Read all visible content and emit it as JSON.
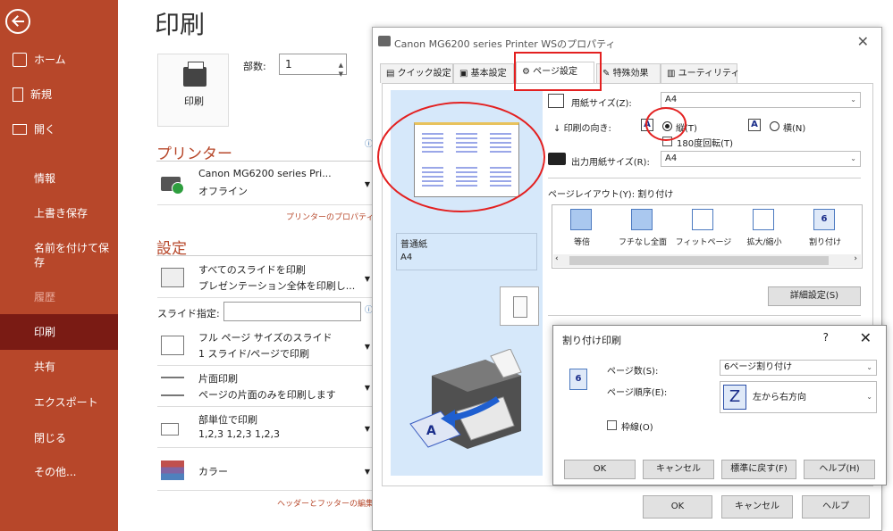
{
  "sidebar": {
    "items": [
      {
        "label": "ホーム",
        "icon": "home-icon"
      },
      {
        "label": "新規",
        "icon": "new-document-icon"
      },
      {
        "label": "開く",
        "icon": "open-folder-icon"
      },
      {
        "label": "情報"
      },
      {
        "label": "上書き保存"
      },
      {
        "label": "名前を付けて保\n存"
      },
      {
        "label": "履歴"
      },
      {
        "label": "印刷"
      },
      {
        "label": "共有"
      },
      {
        "label": "エクスポート"
      },
      {
        "label": "閉じる"
      },
      {
        "label": "その他..."
      }
    ],
    "active": "印刷"
  },
  "print_pane": {
    "title": "印刷",
    "print_button": "印刷",
    "copies_label": "部数:",
    "copies_value": "1",
    "printer_heading": "プリンター",
    "printer_name": "Canon MG6200 series Pri...",
    "printer_status": "オフライン",
    "printer_props_link": "プリンターのプロパティ",
    "settings_heading": "設定",
    "opt_slides_l1": "すべてのスライドを印刷",
    "opt_slides_l2": "プレゼンテーション全体を印刷し...",
    "slide_spec_label": "スライド指定:",
    "opt_layout_l1": "フル ページ サイズのスライド",
    "opt_layout_l2": "1 スライド/ページで印刷",
    "opt_sides_l1": "片面印刷",
    "opt_sides_l2": "ページの片面のみを印刷します",
    "opt_collate_l1": "部単位で印刷",
    "opt_collate_l2": "1,2,3    1,2,3    1,2,3",
    "opt_color_l1": "カラー",
    "header_footer_link": "ヘッダーとフッターの編集"
  },
  "props_dialog": {
    "title": "Canon MG6200 series Printer WSのプロパティ",
    "tabs": [
      "クイック設定",
      "基本設定",
      "ページ設定",
      "特殊効果",
      "ユーティリティ"
    ],
    "selected_tab": "ページ設定",
    "paper_size_label": "用紙サイズ(Z):",
    "paper_size_value": "A4",
    "orientation_label": "印刷の向き:",
    "portrait_label": "縦(T)",
    "landscape_label": "横(N)",
    "rotate_label": "180度回転(T)",
    "output_size_label": "出力用紙サイズ(R):",
    "output_size_value": "A4",
    "page_layout_label": "ページレイアウト(Y):  割り付け",
    "layouts": [
      "等倍",
      "フチなし全面",
      "フィットページ",
      "拡大/縮小",
      "割り付け"
    ],
    "paper_info": "普通紙\nA4",
    "detail_button": "詳細設定(S)",
    "ok": "OK",
    "cancel": "キャンセル",
    "help": "ヘルプ"
  },
  "nup_dialog": {
    "title": "割り付け印刷",
    "help_glyph": "?",
    "pages_label": "ページ数(S):",
    "pages_value": "6ページ割り付け",
    "order_label": "ページ順序(E):",
    "order_value": "左から右方向",
    "border_label": "枠線(O)",
    "ok": "OK",
    "cancel": "キャンセル",
    "defaults": "標準に戻す(F)",
    "help": "ヘルプ(H)",
    "icon_number": "6",
    "dialog_number_icon": "6"
  },
  "colors": {
    "sidebar": "#b7472a",
    "sidebar_active": "#7a1b14",
    "accent": "#b7472a",
    "annotation_red": "#e32020",
    "preview_bg": "#d6e8fa"
  }
}
